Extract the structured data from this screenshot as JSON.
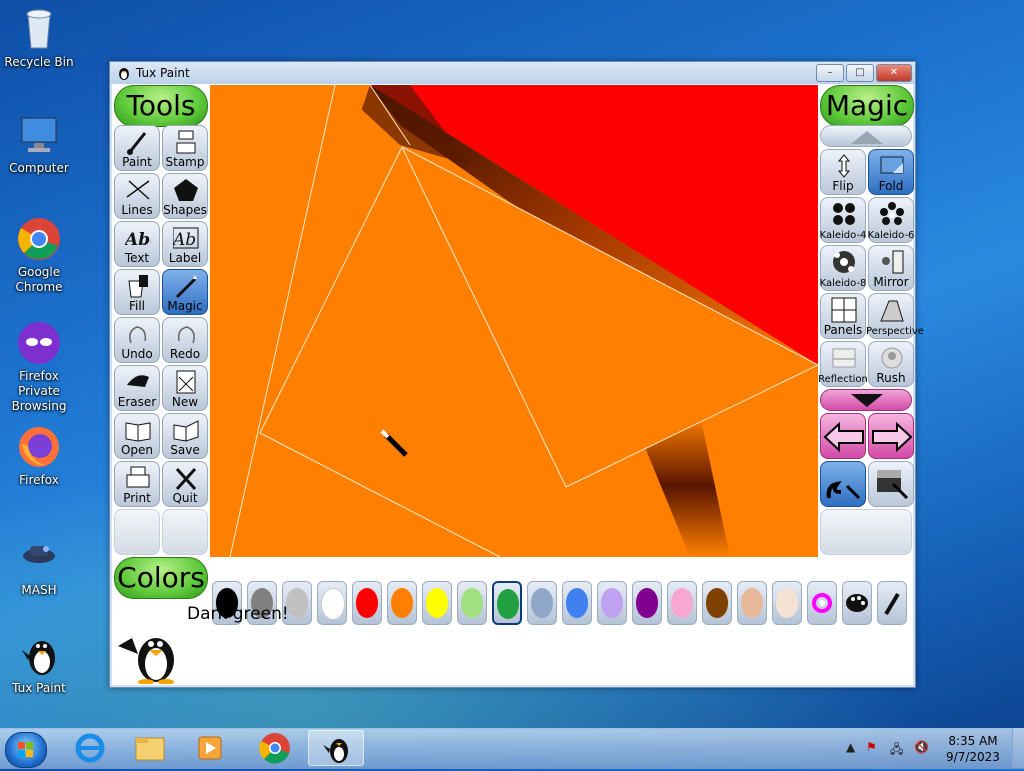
{
  "desktop": {
    "icons": [
      {
        "name": "recycle-bin",
        "label": "Recycle Bin"
      },
      {
        "name": "computer",
        "label": "Computer"
      },
      {
        "name": "google-chrome",
        "label": "Google Chrome"
      },
      {
        "name": "firefox-private",
        "label": "Firefox Private Browsing"
      },
      {
        "name": "firefox",
        "label": "Firefox"
      },
      {
        "name": "mash",
        "label": "MASH"
      },
      {
        "name": "tux-paint",
        "label": "Tux Paint"
      }
    ]
  },
  "window": {
    "title": "Tux Paint",
    "controls": {
      "minimize": "–",
      "maximize": "□",
      "close": "✕"
    }
  },
  "tools": {
    "header": "Tools",
    "items": [
      {
        "label": "Paint",
        "icon": "paintbrush-icon"
      },
      {
        "label": "Stamp",
        "icon": "stamp-icon"
      },
      {
        "label": "Lines",
        "icon": "lines-icon"
      },
      {
        "label": "Shapes",
        "icon": "pentagon-icon"
      },
      {
        "label": "Text",
        "icon": "text-abc-icon"
      },
      {
        "label": "Label",
        "icon": "label-abc-icon"
      },
      {
        "label": "Fill",
        "icon": "paint-bucket-icon"
      },
      {
        "label": "Magic",
        "icon": "magic-wand-icon",
        "selected": true
      },
      {
        "label": "Undo",
        "icon": "undo-hand-icon"
      },
      {
        "label": "Redo",
        "icon": "redo-hand-icon"
      },
      {
        "label": "Eraser",
        "icon": "eraser-icon"
      },
      {
        "label": "New",
        "icon": "new-page-icon"
      },
      {
        "label": "Open",
        "icon": "open-book-icon"
      },
      {
        "label": "Save",
        "icon": "save-book-icon"
      },
      {
        "label": "Print",
        "icon": "printer-icon"
      },
      {
        "label": "Quit",
        "icon": "quit-x-icon"
      }
    ]
  },
  "magic": {
    "header": "Magic",
    "items": [
      {
        "label": "Flip",
        "icon": "flip-icon"
      },
      {
        "label": "Fold",
        "icon": "fold-icon",
        "selected": true
      },
      {
        "label": "Kaleido-4",
        "icon": "kaleido-4-icon"
      },
      {
        "label": "Kaleido-6",
        "icon": "kaleido-6-icon"
      },
      {
        "label": "Kaleido-8",
        "icon": "kaleido-8-icon"
      },
      {
        "label": "Mirror",
        "icon": "mirror-icon"
      },
      {
        "label": "Panels",
        "icon": "panels-icon"
      },
      {
        "label": "Perspective",
        "icon": "perspective-icon"
      },
      {
        "label": "Reflection",
        "icon": "reflection-icon"
      },
      {
        "label": "Rush",
        "icon": "rush-icon"
      }
    ]
  },
  "colors": {
    "header": "Colors",
    "swatches": [
      "#000000",
      "#808080",
      "#c0c0c0",
      "#ffffff",
      "#ff0000",
      "#ff8000",
      "#ffff00",
      "#a0e080",
      "#20a040",
      "#90a8c8",
      "#4080f0",
      "#c0a0f0",
      "#800090",
      "#f8a8d0",
      "#804000",
      "#e8b89a",
      "#f4e2d2"
    ],
    "selected_index": 8
  },
  "status": {
    "message": "Dark green!"
  },
  "taskbar": {
    "time": "8:35 AM",
    "date": "9/7/2023",
    "apps": [
      "internet-explorer",
      "file-explorer",
      "media-player",
      "google-chrome",
      "tux-paint"
    ],
    "active_app": "tux-paint"
  }
}
